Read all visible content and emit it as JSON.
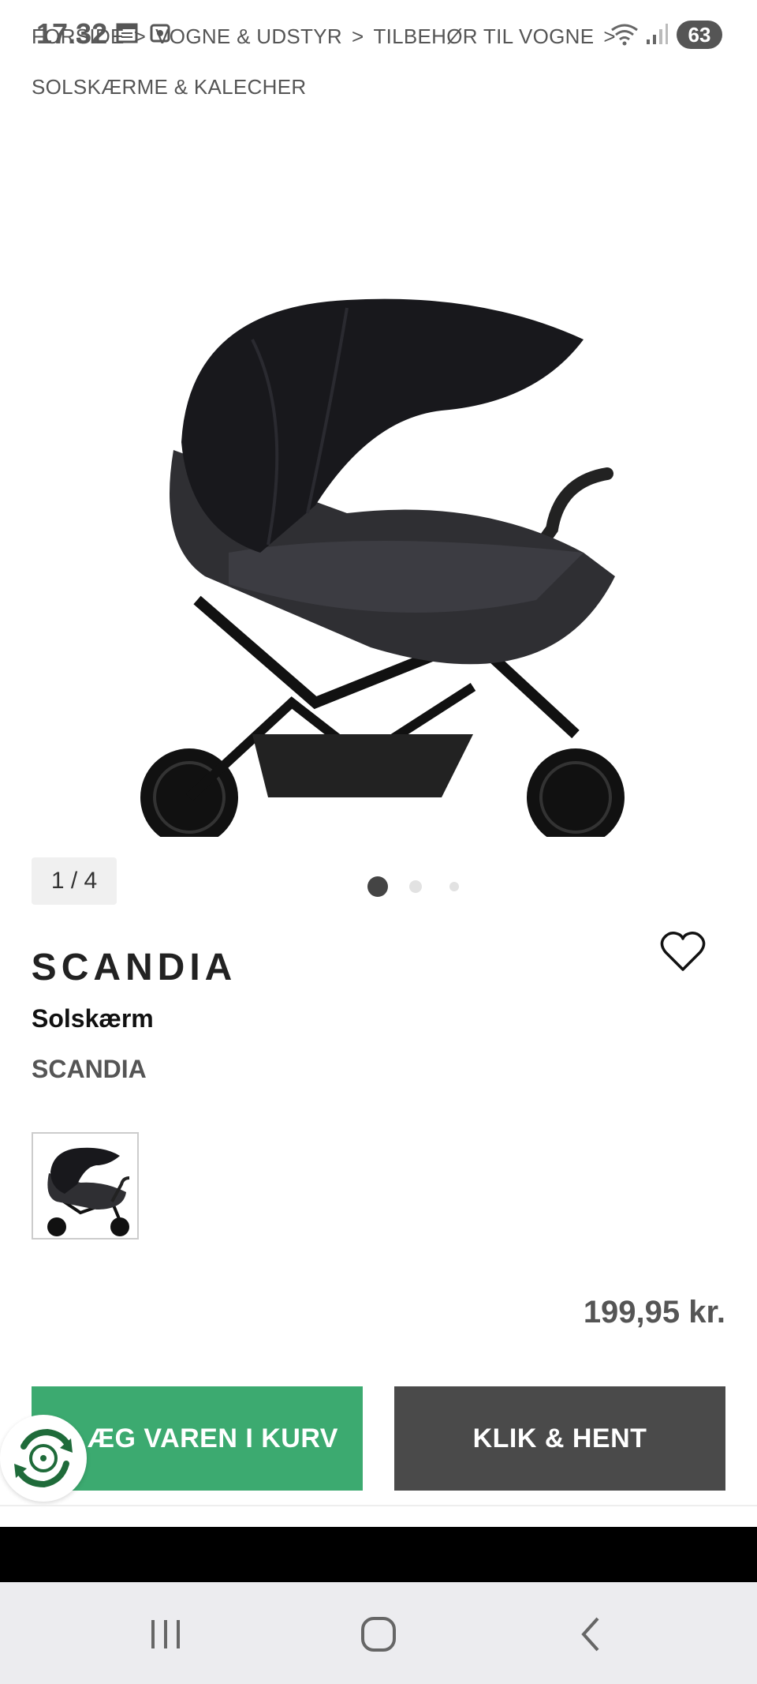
{
  "status_bar": {
    "time": "17.32",
    "battery": "63"
  },
  "breadcrumb": {
    "items": [
      "FORSIDE",
      "VOGNE & UDSTYR",
      "TILBEHØR TIL VOGNE",
      "SOLSKÆRME & KALECHER"
    ],
    "separator": ">"
  },
  "gallery": {
    "counter": "1 / 4"
  },
  "product": {
    "brand_logo": "SCANDIA",
    "title": "Solskærm",
    "brand": "SCANDIA",
    "price": "199,95 kr."
  },
  "actions": {
    "add_to_cart": "ÆG VAREN I KURV",
    "click_collect": "KLIK & HENT"
  },
  "colors": {
    "accent_green": "#3caa70",
    "dark_button": "#4a4a4a",
    "text_gray": "#555555"
  },
  "icons": [
    "calendar-icon",
    "screenshot-icon",
    "wifi-icon",
    "signal-icon",
    "heart-icon",
    "recycle-icon",
    "recents-icon",
    "home-icon",
    "back-icon"
  ]
}
